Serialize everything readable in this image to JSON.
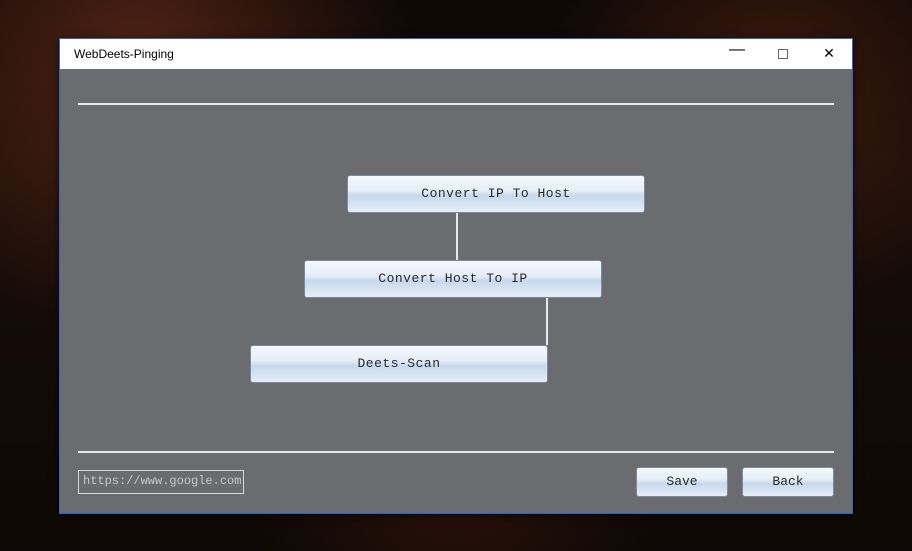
{
  "window": {
    "title": "WebDeets-Pinging"
  },
  "options": {
    "convert_ip_to_host": "Convert IP To Host",
    "convert_host_to_ip": "Convert Host To IP",
    "deets_scan": "Deets-Scan"
  },
  "footer": {
    "url_value": "https://www.google.com",
    "save_label": "Save",
    "back_label": "Back"
  }
}
